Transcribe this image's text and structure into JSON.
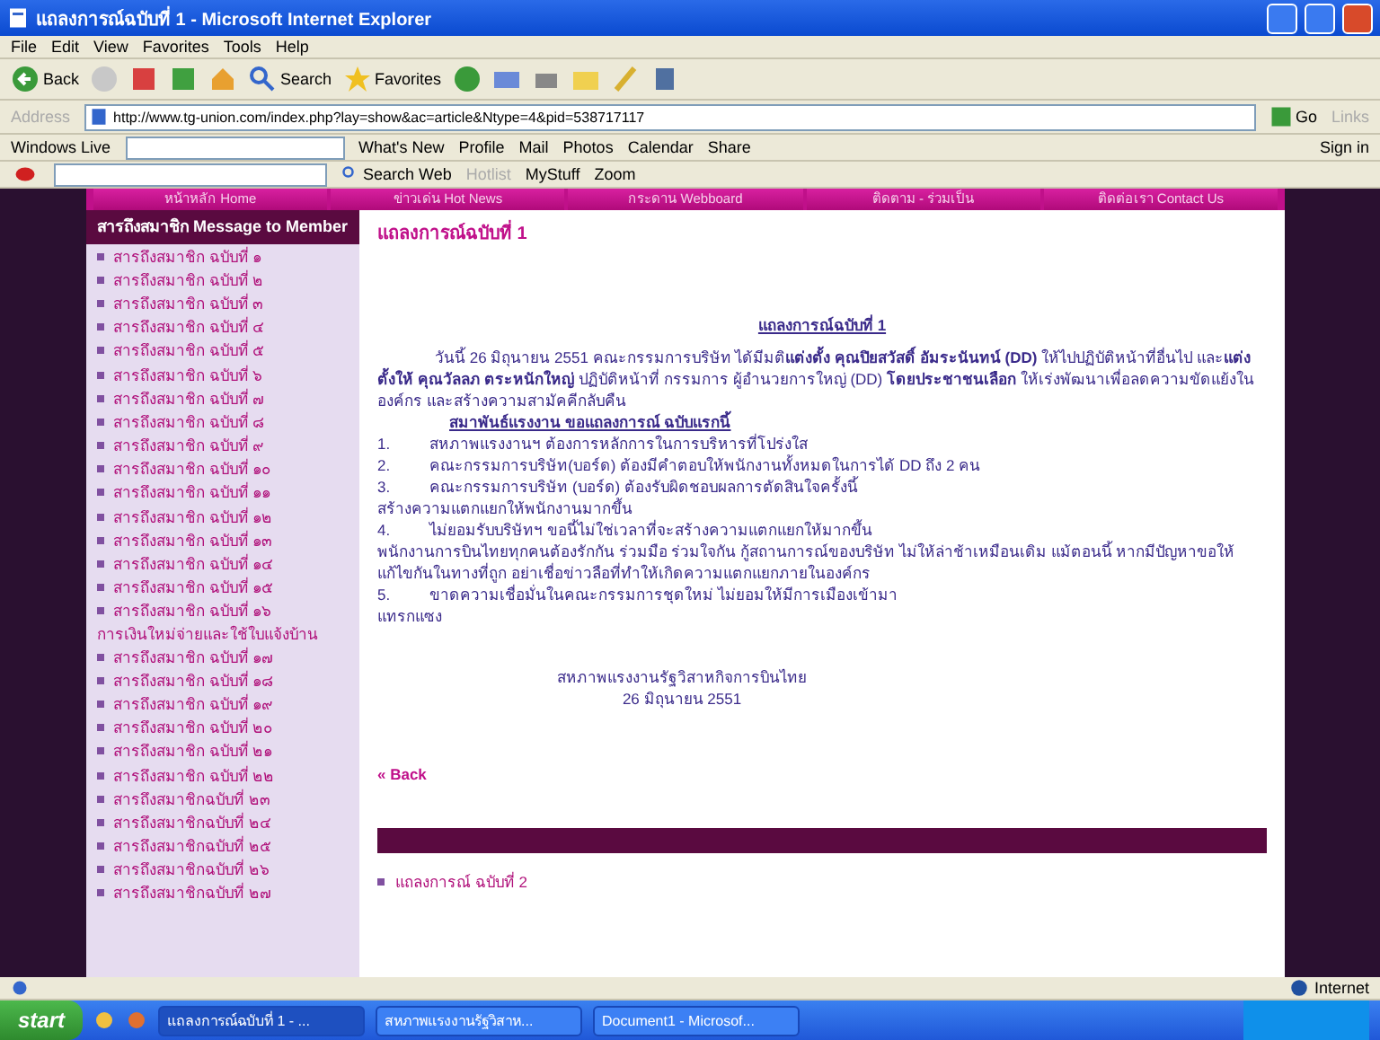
{
  "window": {
    "title": "แถลงการณ์ฉบับที่ 1 - Microsoft Internet Explorer"
  },
  "menu": [
    "File",
    "Edit",
    "View",
    "Favorites",
    "Tools",
    "Help"
  ],
  "toolbar": {
    "back": "Back",
    "search": "Search",
    "favorites": "Favorites"
  },
  "address": {
    "label": "Address",
    "value": "http://www.tg-union.com/index.php?lay=show&ac=article&Ntype=4&pid=538717117",
    "go": "Go",
    "links": "Links"
  },
  "live_bar": {
    "brand": "Windows Live",
    "items": [
      "What's New",
      "Profile",
      "Mail",
      "Photos",
      "Calendar",
      "Share"
    ],
    "sign_in": "Sign in"
  },
  "yahoo_bar": {
    "search": "Search Web",
    "items": [
      {
        "label": "Hotlist",
        "disabled": true
      },
      {
        "label": "MyStuff",
        "disabled": false
      },
      {
        "label": "Zoom",
        "disabled": false
      }
    ]
  },
  "nav": [
    "หน้าหลัก Home",
    "ข่าวเด่น Hot News",
    "กระดาน Webboard",
    "ติดตาม - ร่วมเป็น",
    "ติดต่อเรา Contact Us"
  ],
  "sidebar": {
    "title": "สารถึงสมาชิก Message to Member",
    "items": [
      {
        "kind": "link",
        "label": "สารถึงสมาชิก ฉบับที่ ๑"
      },
      {
        "kind": "link",
        "label": "สารถึงสมาชิก ฉบับที่ ๒"
      },
      {
        "kind": "link",
        "label": "สารถึงสมาชิก ฉบับที่ ๓"
      },
      {
        "kind": "link",
        "label": "สารถึงสมาชิก ฉบับที่ ๔"
      },
      {
        "kind": "link",
        "label": "สารถึงสมาชิก ฉบับที่ ๕"
      },
      {
        "kind": "link",
        "label": "สารถึงสมาชิก ฉบับที่ ๖"
      },
      {
        "kind": "link",
        "label": "สารถึงสมาชิก ฉบับที่ ๗"
      },
      {
        "kind": "link",
        "label": "สารถึงสมาชิก ฉบับที่ ๘"
      },
      {
        "kind": "link",
        "label": "สารถึงสมาชิก ฉบับที่ ๙"
      },
      {
        "kind": "link",
        "label": "สารถึงสมาชิก ฉบับที่ ๑๐"
      },
      {
        "kind": "link",
        "label": "สารถึงสมาชิก ฉบับที่ ๑๑"
      },
      {
        "kind": "link",
        "label": "สารถึงสมาชิก ฉบับที่ ๑๒"
      },
      {
        "kind": "link",
        "label": "สารถึงสมาชิก ฉบับที่ ๑๓"
      },
      {
        "kind": "link",
        "label": "สารถึงสมาชิก ฉบับที่ ๑๔"
      },
      {
        "kind": "link",
        "label": "สารถึงสมาชิก ฉบับที่ ๑๕"
      },
      {
        "kind": "link",
        "label": "สารถึงสมาชิก ฉบับที่ ๑๖"
      },
      {
        "kind": "heading",
        "label": "การเงินใหม่จ่ายและใช้ใบแจ้งบ้าน"
      },
      {
        "kind": "link",
        "label": "สารถึงสมาชิก ฉบับที่ ๑๗"
      },
      {
        "kind": "link",
        "label": "สารถึงสมาชิก ฉบับที่ ๑๘"
      },
      {
        "kind": "link",
        "label": "สารถึงสมาชิก ฉบับที่ ๑๙"
      },
      {
        "kind": "link",
        "label": "สารถึงสมาชิก ฉบับที่ ๒๐"
      },
      {
        "kind": "link",
        "label": "สารถึงสมาชิก ฉบับที่ ๒๑"
      },
      {
        "kind": "link",
        "label": "สารถึงสมาชิก ฉบับที่ ๒๒"
      },
      {
        "kind": "link",
        "label": "สารถึงสมาชิกฉบับที่ ๒๓"
      },
      {
        "kind": "link",
        "label": "สารถึงสมาชิกฉบับที่ ๒๔"
      },
      {
        "kind": "link",
        "label": "สารถึงสมาชิกฉบับที่ ๒๕"
      },
      {
        "kind": "link",
        "label": "สารถึงสมาชิกฉบับที่ ๒๖"
      },
      {
        "kind": "link",
        "label": "สารถึงสมาชิกฉบับที่ ๒๗"
      }
    ]
  },
  "article": {
    "page_title": "แถลงการณ์ฉบับที่ 1",
    "heading": "แถลงการณ์ฉบับที่ 1",
    "intro": "วันนี้ 26 มิถุนายน 2551 คณะกรรมการบริษัท ได้มีมติ**แต่งตั้ง** **คุณปิยสวัสดิ์ อัมระนันทน์ (DD)** ให้ไปปฏิบัติหน้าที่อื่นไป และ**แต่งตั้งให้** **คุณวัลลภ ตระหนักใหญ่** ปฏิบัติหน้าที่ กรรมการ ผู้อำนวยการใหญ่ (DD) **โดยประชาชนเลือก** ให้เร่งพัฒนาเพื่อลดความขัดแย้งในองค์กร และสร้างความสามัคคีกลับคืน",
    "subheading": "สมาพันธ์แรงงาน ขอแถลงการณ์ ฉบับแรกนี้",
    "points": [
      {
        "number": "1.",
        "text": "สหภาพแรงงานฯ ต้องการหลักการในการบริหารที่โปร่งใส"
      },
      {
        "number": "2.",
        "text": "คณะกรรมการบริษัท(บอร์ด) ต้องมีคำตอบให้พนักงานทั้งหมดในการได้ DD ถึง 2 คน"
      },
      {
        "number": "3.",
        "text": "คณะกรรมการบริษัท (บอร์ด) ต้องรับผิดชอบผลการตัดสินใจครั้งนี้",
        "cont": "สร้างความแตกแยกให้พนักงานมากขึ้น"
      },
      {
        "number": "4.",
        "text": "ไม่ยอมรับบริษัทฯ ขอนี้ไม่ใช่เวลาที่จะสร้างความแตกแยกให้มากขึ้น",
        "cont": "พนักงานการบินไทยทุกคนต้องรักกัน ร่วมมือ ร่วมใจกัน กู้สถานการณ์ของบริษัท ไม่ให้ล่าช้าเหมือนเดิม แม้ตอนนี้ หากมีปัญหาขอให้แก้ไขกันในทางที่ถูก อย่าเชื่อข่าวลือที่ทำให้เกิดความแตกแยกภายในองค์กร"
      },
      {
        "number": "5.",
        "text": "ขาดความเชื่อมั่นในคณะกรรมการชุดใหม่ ไม่ยอมให้มีการเมืองเข้ามา",
        "cont": "แทรกแซง"
      }
    ],
    "signature": "สหภาพแรงงานรัฐวิสาหกิจการบินไทย",
    "date": "26 มิถุนายน 2551",
    "back": "« Back",
    "related": [
      "แถลงการณ์ ฉบับที่ 2"
    ]
  },
  "status_bar": {
    "zone": "Internet"
  },
  "taskbar": {
    "start": "start",
    "windows": [
      {
        "label": "แถลงการณ์ฉบับที่ 1 - ...",
        "selected": true
      },
      {
        "label": "สหภาพแรงงานรัฐวิสาห...",
        "selected": false
      },
      {
        "label": "Document1 - Microsof...",
        "selected": false
      }
    ]
  }
}
